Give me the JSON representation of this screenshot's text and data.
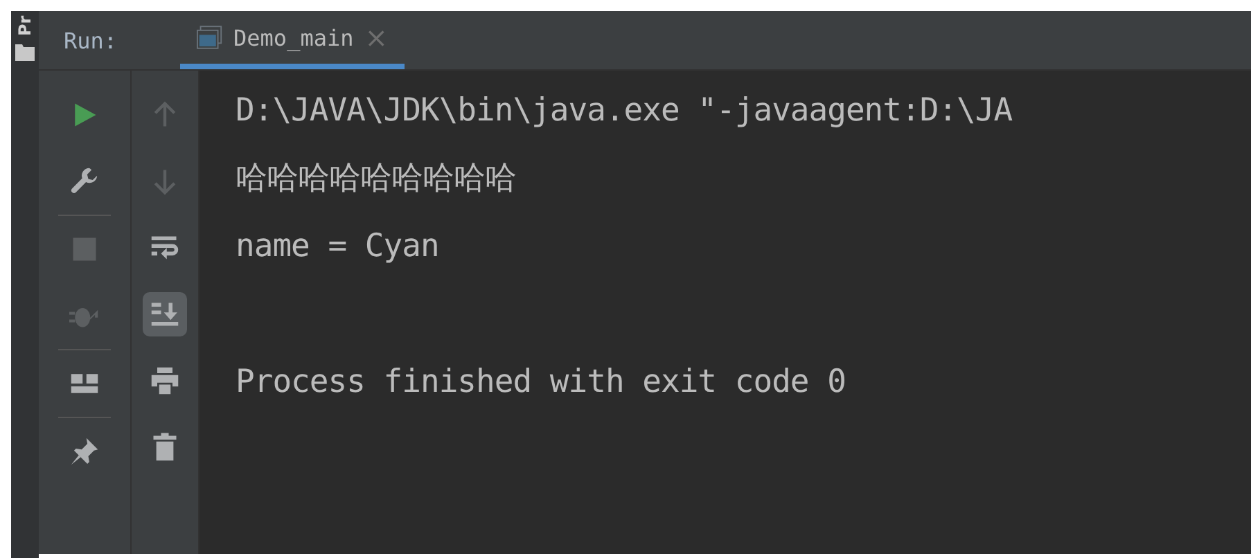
{
  "side_strip": {
    "label": "Pr"
  },
  "run_bar": {
    "label": "Run:",
    "tabs": [
      {
        "label": "Demo_main",
        "selected": true,
        "close": "×"
      }
    ]
  },
  "toolbar_left": [
    {
      "kind": "run",
      "disabled": false,
      "divider_after": false
    },
    {
      "kind": "wrench",
      "disabled": false,
      "divider_after": true
    },
    {
      "kind": "stop",
      "disabled": true,
      "divider_after": false
    },
    {
      "kind": "debug",
      "disabled": true,
      "divider_after": true
    },
    {
      "kind": "layout",
      "disabled": false,
      "divider_after": true
    },
    {
      "kind": "pin",
      "disabled": false,
      "divider_after": false
    }
  ],
  "toolbar_right": [
    {
      "kind": "up",
      "disabled": true,
      "selected": false
    },
    {
      "kind": "down",
      "disabled": true,
      "selected": false
    },
    {
      "kind": "wrap",
      "disabled": false,
      "selected": false
    },
    {
      "kind": "scroll_end",
      "disabled": false,
      "selected": true
    },
    {
      "kind": "print",
      "disabled": false,
      "selected": false
    },
    {
      "kind": "trash",
      "disabled": false,
      "selected": false
    }
  ],
  "console": {
    "lines": [
      {
        "text": "D:\\JAVA\\JDK\\bin\\java.exe \"-javaagent:D:\\JA",
        "blank_before": false
      },
      {
        "text": "哈哈哈哈哈哈哈哈哈",
        "blank_before": false
      },
      {
        "text": "name = Cyan",
        "blank_before": false
      },
      {
        "text": "Process finished with exit code 0",
        "blank_before": true
      }
    ]
  }
}
